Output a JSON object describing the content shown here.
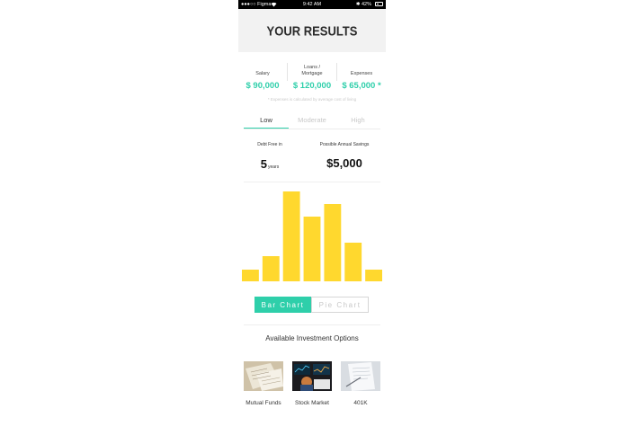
{
  "status_bar": {
    "carrier": "●●●○○ Figma",
    "wifi": "wifi-icon",
    "time": "9:42 AM",
    "battery_text": "✱ 42%",
    "battery_level": 0.42
  },
  "header": {
    "title": "YOUR RESULTS"
  },
  "stats": [
    {
      "label": "Salary",
      "value": "$ 90,000"
    },
    {
      "label": "Loans /\nMortgage",
      "value": "$ 120,000"
    },
    {
      "label": "Expenses",
      "value": "$ 65,000 *"
    }
  ],
  "note": "* Expenses is calculated by average cost of living",
  "tabs": [
    {
      "label": "Low",
      "active": true
    },
    {
      "label": "Moderate",
      "active": false
    },
    {
      "label": "High",
      "active": false
    }
  ],
  "summary": {
    "debt_label": "Debt Free in",
    "years_value": "5",
    "years_unit": "years",
    "savings_label": "Possible Annual Savings",
    "savings_value": "$5,000"
  },
  "colors": {
    "accent": "#2ecfaa",
    "bar": "#ffd82e"
  },
  "chart_data": {
    "type": "bar",
    "categories": [
      "",
      "",
      "",
      "",
      "",
      "",
      ""
    ],
    "values": [
      13,
      28,
      100,
      72,
      86,
      43,
      13
    ],
    "ylim": [
      0,
      100
    ],
    "title": "",
    "xlabel": "",
    "ylabel": "",
    "grid": false
  },
  "chart_toggle": {
    "bar_label": "Bar Chart",
    "pie_label": "Pie Chart"
  },
  "investments": {
    "title": "Available Investment Options",
    "items": [
      {
        "name": "Mutual Funds",
        "icon": "documents-photo"
      },
      {
        "name": "Stock Market",
        "icon": "trading-screens-photo"
      },
      {
        "name": "401K",
        "icon": "paperwork-photo"
      }
    ]
  }
}
